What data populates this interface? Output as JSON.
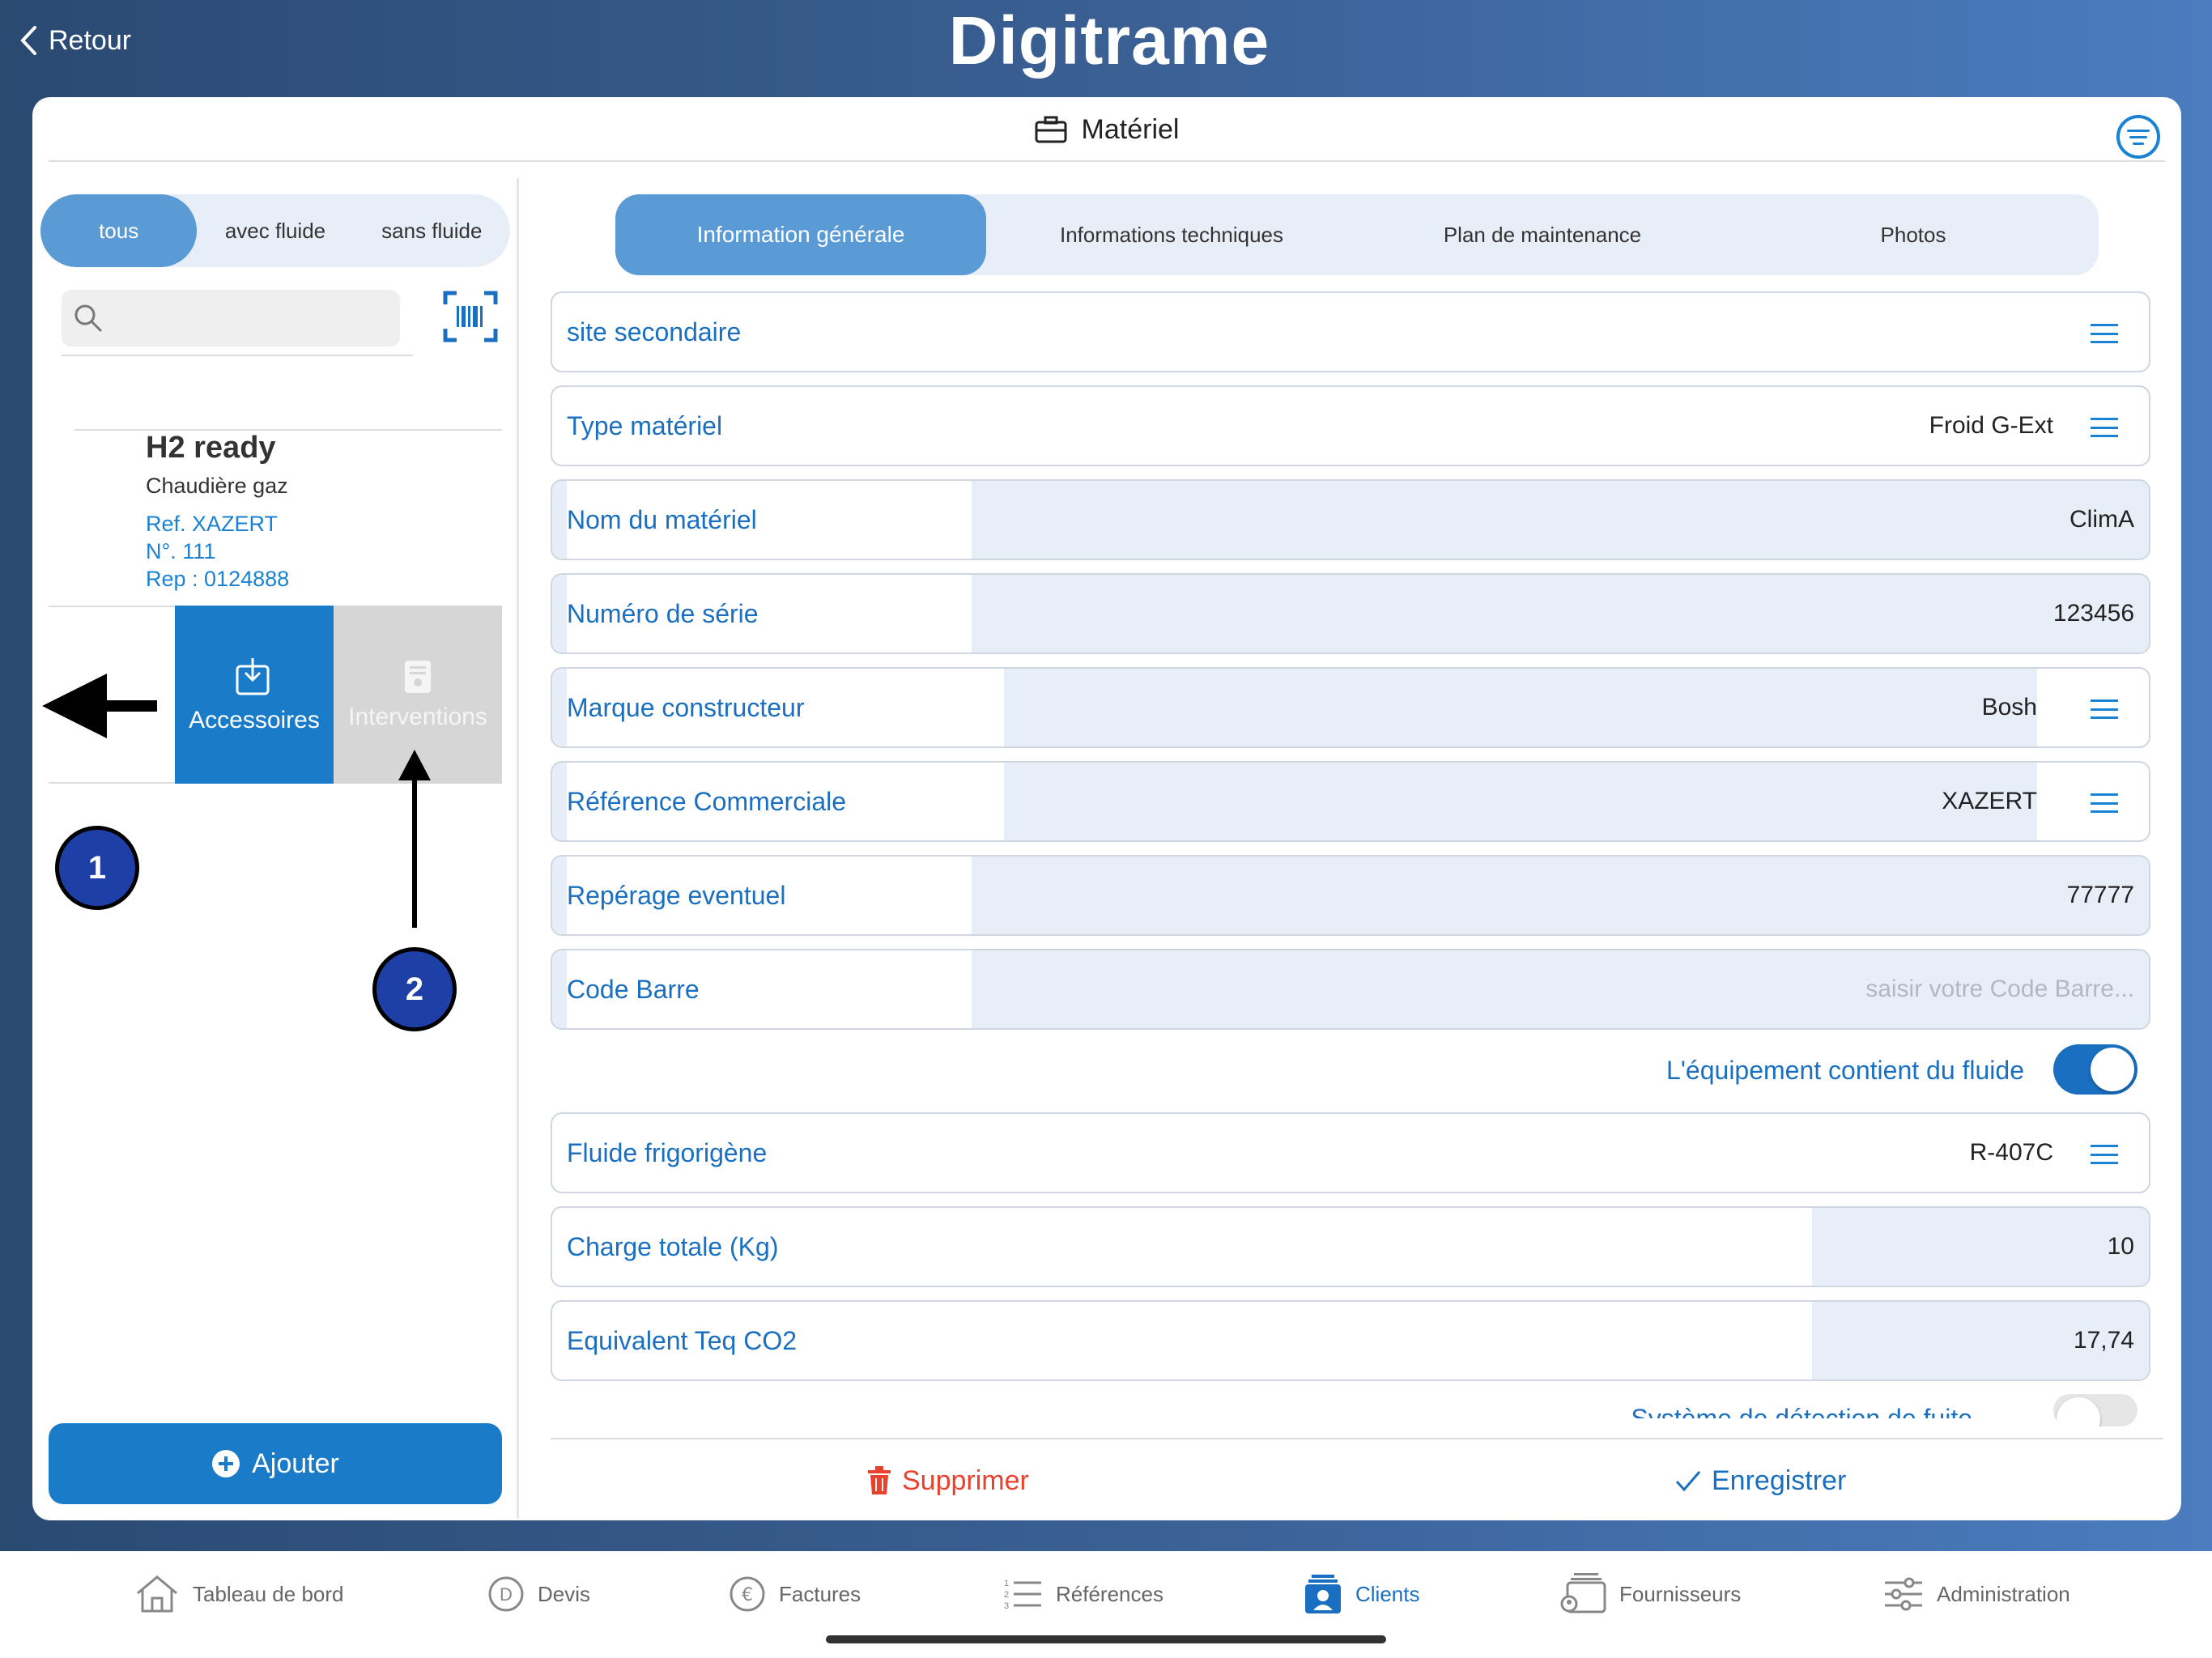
{
  "header": {
    "back_label": "Retour",
    "logo_text": "Digitrame",
    "card_title": "Matériel"
  },
  "filter_segments": [
    {
      "label": "tous",
      "active": true
    },
    {
      "label": "avec fluide",
      "active": false
    },
    {
      "label": "sans fluide",
      "active": false
    }
  ],
  "item": {
    "title": "H2 ready",
    "subtitle": "Chaudière gaz",
    "ref": "Ref. XAZERT",
    "number": "N°. 111",
    "rep": "Rep : 0124888"
  },
  "item_actions": {
    "accessories_label": "Accessoires",
    "interventions_label": "Interventions"
  },
  "badges": {
    "badge1": "1",
    "badge2": "2"
  },
  "add_label": "Ajouter",
  "tabs": [
    {
      "label": "Information générale",
      "active": true
    },
    {
      "label": "Informations techniques",
      "active": false
    },
    {
      "label": "Plan de maintenance",
      "active": false
    },
    {
      "label": "Photos",
      "active": false
    }
  ],
  "form": {
    "site_secondaire": {
      "label": "site secondaire",
      "value": ""
    },
    "type_materiel": {
      "label": "Type matériel",
      "value": "Froid G-Ext"
    },
    "nom_materiel": {
      "label": "Nom du matériel",
      "value": "ClimA"
    },
    "numero_serie": {
      "label": "Numéro de série",
      "value": "123456"
    },
    "marque": {
      "label": "Marque constructeur",
      "value": "Bosh"
    },
    "reference_commerciale": {
      "label": "Référence Commerciale",
      "value": "XAZERT"
    },
    "reperage": {
      "label": "Repérage eventuel",
      "value": "77777"
    },
    "code_barre": {
      "label": "Code Barre",
      "placeholder": "saisir votre Code Barre..."
    },
    "contient_fluide": {
      "label": "L'équipement contient du fluide",
      "on": true
    },
    "fluide": {
      "label": "Fluide frigorigène",
      "value": "R-407C"
    },
    "charge_totale": {
      "label": "Charge totale (Kg)",
      "value": "10"
    },
    "equivalent_co2": {
      "label": "Equivalent Teq CO2",
      "value": "17,74"
    },
    "detection_fuite": {
      "label": "Système de détection de fuite",
      "on": false
    }
  },
  "actions": {
    "delete_label": "Supprimer",
    "save_label": "Enregistrer"
  },
  "bottom_nav": [
    {
      "label": "Tableau de bord",
      "icon": "home-icon",
      "active": false
    },
    {
      "label": "Devis",
      "icon": "quote-icon",
      "active": false
    },
    {
      "label": "Factures",
      "icon": "euro-icon",
      "active": false
    },
    {
      "label": "Références",
      "icon": "list-icon",
      "active": false
    },
    {
      "label": "Clients",
      "icon": "client-icon",
      "active": true
    },
    {
      "label": "Fournisseurs",
      "icon": "supplier-icon",
      "active": false
    },
    {
      "label": "Administration",
      "icon": "settings-sliders-icon",
      "active": false
    }
  ],
  "colors": {
    "accent": "#1a7bc9",
    "label_blue": "#1a6fc0",
    "delete_red": "#e8422f",
    "tab_active": "#5b9bd5"
  }
}
